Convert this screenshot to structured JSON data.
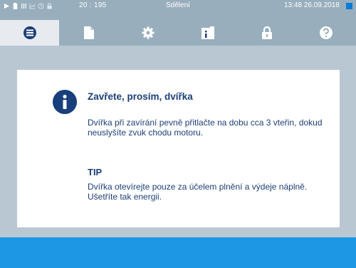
{
  "status_bar": {
    "counter": "20 : 195",
    "title": "Sdělení",
    "time": "13:48",
    "date": "26.09.2018",
    "icons": [
      "play-icon",
      "document-icon",
      "steam-icon",
      "chart-icon",
      "clock-icon",
      "lock-icon"
    ]
  },
  "tabs": [
    {
      "icon": "menu-list-icon",
      "active": true
    },
    {
      "icon": "document-icon",
      "active": false
    },
    {
      "icon": "gear-icon",
      "active": false
    },
    {
      "icon": "info-document-icon",
      "active": false
    },
    {
      "icon": "lock-icon",
      "active": false
    },
    {
      "icon": "help-icon",
      "active": false
    }
  ],
  "message": {
    "heading": "Zavřete, prosím, dvířka",
    "body": "Dvířka při zavírání pevně přitlačte na dobu cca 3 vteřin, dokud neuslyšíte zvuk chodu motoru.",
    "tip_heading": "TIP",
    "tip_body": "Dvířka otevírejte pouze za účelem plnění a výdeje náplně. Ušetříte tak energii."
  },
  "colors": {
    "background": "#b9c7d3",
    "bar": "#98aebd",
    "active_tab": "#e7ebf0",
    "text": "#1c3f78",
    "info_icon": "#183f7c",
    "bottom_bar": "#1d97e4",
    "indicator": "#0b7cd6"
  }
}
